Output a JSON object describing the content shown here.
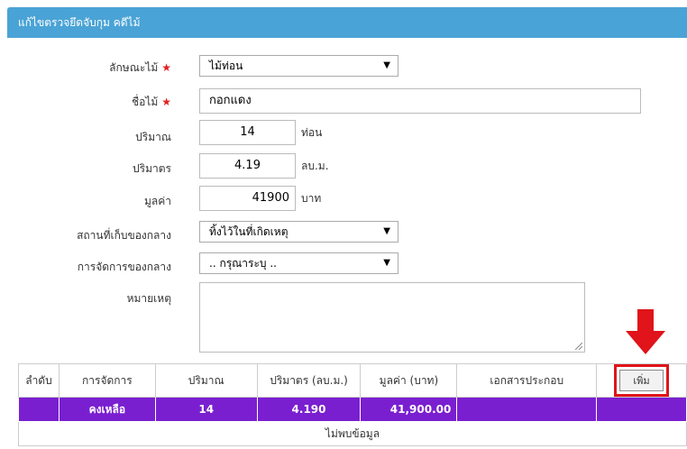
{
  "header": {
    "title": "แก้ไขตรวจยึดจับกุม คดีไม้"
  },
  "form": {
    "wood_type": {
      "label": "ลักษณะไม้",
      "value": "ไม้ท่อน",
      "required_mark": "★"
    },
    "wood_name": {
      "label": "ชื่อไม้",
      "value": "กอกแดง",
      "required_mark": "★"
    },
    "quantity": {
      "label": "ปริมาณ",
      "value": "14",
      "unit": "ท่อน"
    },
    "volume": {
      "label": "ปริมาตร",
      "value": "4.19",
      "unit": "ลบ.ม."
    },
    "amount": {
      "label": "มูลค่า",
      "value": "41900",
      "unit": "บาท"
    },
    "storage": {
      "label": "สถานที่เก็บของกลาง",
      "value": "ทิ้งไว้ในที่เกิดเหตุ"
    },
    "handling": {
      "label": "การจัดการของกลาง",
      "value": ".. กรุณาระบุ .."
    },
    "remark": {
      "label": "หมายเหตุ",
      "value": ""
    }
  },
  "table": {
    "headers": [
      "ลำดับ",
      "การจัดการ",
      "ปริมาณ",
      "ปริมาตร (ลบ.ม.)",
      "มูลค่า (บาท)",
      "เอกสารประกอบ"
    ],
    "add_button": "เพิ่ม",
    "rows": [
      {
        "index": "",
        "handling": "คงเหลือ",
        "quantity": "14",
        "volume": "4.190",
        "amount": "41,900.00",
        "document": "",
        "action": ""
      }
    ],
    "empty_text": "ไม่พบข้อมูล"
  },
  "colors": {
    "header_bg": "#4aa3d6",
    "row_highlight": "#7a1fd0",
    "annotation_red": "#e0141a"
  }
}
